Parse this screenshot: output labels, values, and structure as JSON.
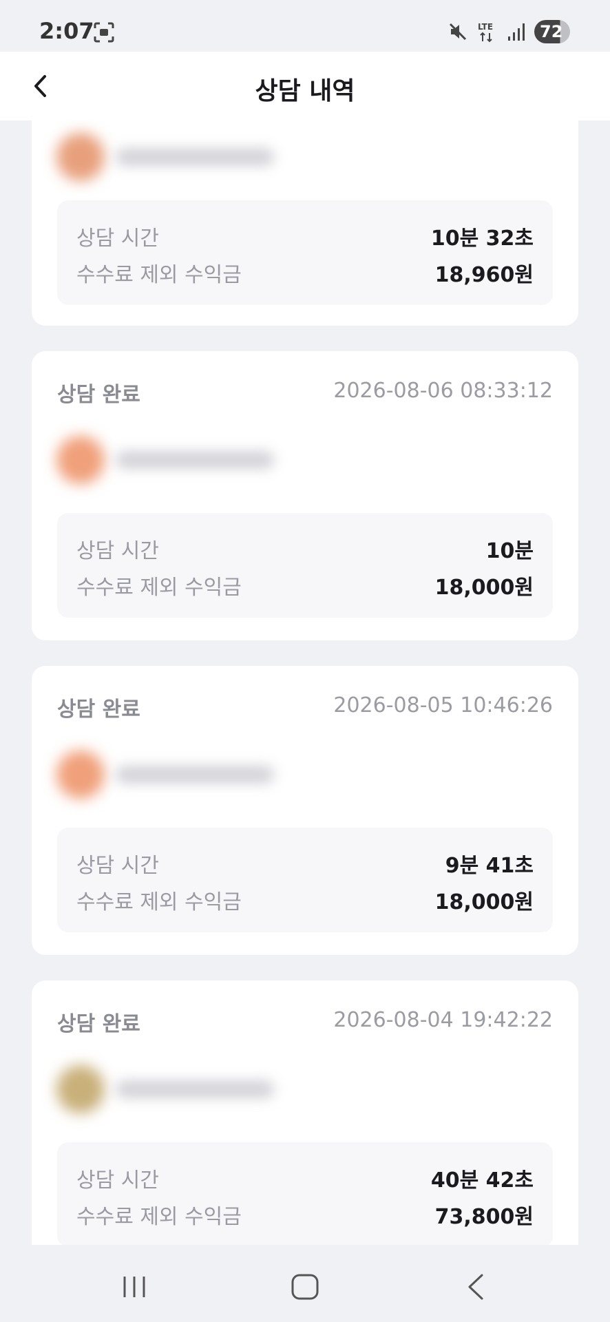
{
  "status_bar": {
    "time": "2:07",
    "network": "LTE",
    "battery": "72",
    "icons": [
      "screenshot-icon",
      "mute-icon",
      "lte-data-icon",
      "signal-icon",
      "battery-icon"
    ]
  },
  "header": {
    "title": "상담 내역",
    "back_icon": "chevron-left-icon"
  },
  "cards": [
    {
      "status": "",
      "date": "",
      "duration_label": "상담 시간",
      "duration": "10분 32초",
      "earnings_label": "수수료 제외 수익금",
      "earnings": "18,960원",
      "avatar_color": "#e8a07c"
    },
    {
      "status": "상담 완료",
      "date": "2026-08-06 08:33:12",
      "duration_label": "상담 시간",
      "duration": "10분",
      "earnings_label": "수수료 제외 수익금",
      "earnings": "18,000원",
      "avatar_color": "#f0a07a"
    },
    {
      "status": "상담 완료",
      "date": "2026-08-05 10:46:26",
      "duration_label": "상담 시간",
      "duration": "9분 41초",
      "earnings_label": "수수료 제외 수익금",
      "earnings": "18,000원",
      "avatar_color": "#f0a07a"
    },
    {
      "status": "상담 완료",
      "date": "2026-08-04 19:42:22",
      "duration_label": "상담 시간",
      "duration": "40분 42초",
      "earnings_label": "수수료 제외 수익금",
      "earnings": "73,800원",
      "avatar_color": "#c9b07a"
    }
  ],
  "nav": {
    "icons": [
      "recent-apps-icon",
      "home-icon",
      "back-icon"
    ]
  }
}
